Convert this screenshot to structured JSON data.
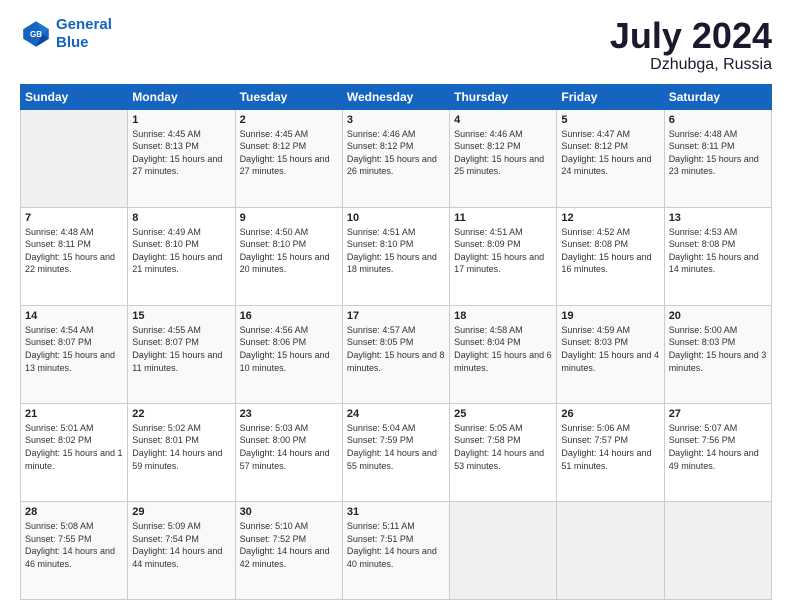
{
  "header": {
    "logo_line1": "General",
    "logo_line2": "Blue",
    "month": "July 2024",
    "location": "Dzhubga, Russia"
  },
  "days_of_week": [
    "Sunday",
    "Monday",
    "Tuesday",
    "Wednesday",
    "Thursday",
    "Friday",
    "Saturday"
  ],
  "weeks": [
    [
      {
        "day": "",
        "sunrise": "",
        "sunset": "",
        "daylight": ""
      },
      {
        "day": "1",
        "sunrise": "Sunrise: 4:45 AM",
        "sunset": "Sunset: 8:13 PM",
        "daylight": "Daylight: 15 hours and 27 minutes."
      },
      {
        "day": "2",
        "sunrise": "Sunrise: 4:45 AM",
        "sunset": "Sunset: 8:12 PM",
        "daylight": "Daylight: 15 hours and 27 minutes."
      },
      {
        "day": "3",
        "sunrise": "Sunrise: 4:46 AM",
        "sunset": "Sunset: 8:12 PM",
        "daylight": "Daylight: 15 hours and 26 minutes."
      },
      {
        "day": "4",
        "sunrise": "Sunrise: 4:46 AM",
        "sunset": "Sunset: 8:12 PM",
        "daylight": "Daylight: 15 hours and 25 minutes."
      },
      {
        "day": "5",
        "sunrise": "Sunrise: 4:47 AM",
        "sunset": "Sunset: 8:12 PM",
        "daylight": "Daylight: 15 hours and 24 minutes."
      },
      {
        "day": "6",
        "sunrise": "Sunrise: 4:48 AM",
        "sunset": "Sunset: 8:11 PM",
        "daylight": "Daylight: 15 hours and 23 minutes."
      }
    ],
    [
      {
        "day": "7",
        "sunrise": "Sunrise: 4:48 AM",
        "sunset": "Sunset: 8:11 PM",
        "daylight": "Daylight: 15 hours and 22 minutes."
      },
      {
        "day": "8",
        "sunrise": "Sunrise: 4:49 AM",
        "sunset": "Sunset: 8:10 PM",
        "daylight": "Daylight: 15 hours and 21 minutes."
      },
      {
        "day": "9",
        "sunrise": "Sunrise: 4:50 AM",
        "sunset": "Sunset: 8:10 PM",
        "daylight": "Daylight: 15 hours and 20 minutes."
      },
      {
        "day": "10",
        "sunrise": "Sunrise: 4:51 AM",
        "sunset": "Sunset: 8:10 PM",
        "daylight": "Daylight: 15 hours and 18 minutes."
      },
      {
        "day": "11",
        "sunrise": "Sunrise: 4:51 AM",
        "sunset": "Sunset: 8:09 PM",
        "daylight": "Daylight: 15 hours and 17 minutes."
      },
      {
        "day": "12",
        "sunrise": "Sunrise: 4:52 AM",
        "sunset": "Sunset: 8:08 PM",
        "daylight": "Daylight: 15 hours and 16 minutes."
      },
      {
        "day": "13",
        "sunrise": "Sunrise: 4:53 AM",
        "sunset": "Sunset: 8:08 PM",
        "daylight": "Daylight: 15 hours and 14 minutes."
      }
    ],
    [
      {
        "day": "14",
        "sunrise": "Sunrise: 4:54 AM",
        "sunset": "Sunset: 8:07 PM",
        "daylight": "Daylight: 15 hours and 13 minutes."
      },
      {
        "day": "15",
        "sunrise": "Sunrise: 4:55 AM",
        "sunset": "Sunset: 8:07 PM",
        "daylight": "Daylight: 15 hours and 11 minutes."
      },
      {
        "day": "16",
        "sunrise": "Sunrise: 4:56 AM",
        "sunset": "Sunset: 8:06 PM",
        "daylight": "Daylight: 15 hours and 10 minutes."
      },
      {
        "day": "17",
        "sunrise": "Sunrise: 4:57 AM",
        "sunset": "Sunset: 8:05 PM",
        "daylight": "Daylight: 15 hours and 8 minutes."
      },
      {
        "day": "18",
        "sunrise": "Sunrise: 4:58 AM",
        "sunset": "Sunset: 8:04 PM",
        "daylight": "Daylight: 15 hours and 6 minutes."
      },
      {
        "day": "19",
        "sunrise": "Sunrise: 4:59 AM",
        "sunset": "Sunset: 8:03 PM",
        "daylight": "Daylight: 15 hours and 4 minutes."
      },
      {
        "day": "20",
        "sunrise": "Sunrise: 5:00 AM",
        "sunset": "Sunset: 8:03 PM",
        "daylight": "Daylight: 15 hours and 3 minutes."
      }
    ],
    [
      {
        "day": "21",
        "sunrise": "Sunrise: 5:01 AM",
        "sunset": "Sunset: 8:02 PM",
        "daylight": "Daylight: 15 hours and 1 minute."
      },
      {
        "day": "22",
        "sunrise": "Sunrise: 5:02 AM",
        "sunset": "Sunset: 8:01 PM",
        "daylight": "Daylight: 14 hours and 59 minutes."
      },
      {
        "day": "23",
        "sunrise": "Sunrise: 5:03 AM",
        "sunset": "Sunset: 8:00 PM",
        "daylight": "Daylight: 14 hours and 57 minutes."
      },
      {
        "day": "24",
        "sunrise": "Sunrise: 5:04 AM",
        "sunset": "Sunset: 7:59 PM",
        "daylight": "Daylight: 14 hours and 55 minutes."
      },
      {
        "day": "25",
        "sunrise": "Sunrise: 5:05 AM",
        "sunset": "Sunset: 7:58 PM",
        "daylight": "Daylight: 14 hours and 53 minutes."
      },
      {
        "day": "26",
        "sunrise": "Sunrise: 5:06 AM",
        "sunset": "Sunset: 7:57 PM",
        "daylight": "Daylight: 14 hours and 51 minutes."
      },
      {
        "day": "27",
        "sunrise": "Sunrise: 5:07 AM",
        "sunset": "Sunset: 7:56 PM",
        "daylight": "Daylight: 14 hours and 49 minutes."
      }
    ],
    [
      {
        "day": "28",
        "sunrise": "Sunrise: 5:08 AM",
        "sunset": "Sunset: 7:55 PM",
        "daylight": "Daylight: 14 hours and 46 minutes."
      },
      {
        "day": "29",
        "sunrise": "Sunrise: 5:09 AM",
        "sunset": "Sunset: 7:54 PM",
        "daylight": "Daylight: 14 hours and 44 minutes."
      },
      {
        "day": "30",
        "sunrise": "Sunrise: 5:10 AM",
        "sunset": "Sunset: 7:52 PM",
        "daylight": "Daylight: 14 hours and 42 minutes."
      },
      {
        "day": "31",
        "sunrise": "Sunrise: 5:11 AM",
        "sunset": "Sunset: 7:51 PM",
        "daylight": "Daylight: 14 hours and 40 minutes."
      },
      {
        "day": "",
        "sunrise": "",
        "sunset": "",
        "daylight": ""
      },
      {
        "day": "",
        "sunrise": "",
        "sunset": "",
        "daylight": ""
      },
      {
        "day": "",
        "sunrise": "",
        "sunset": "",
        "daylight": ""
      }
    ]
  ]
}
